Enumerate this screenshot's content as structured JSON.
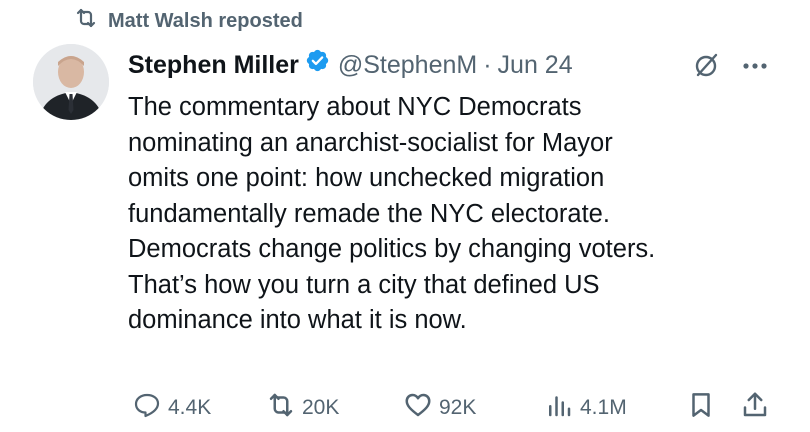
{
  "repost_banner": {
    "text": "Matt Walsh reposted",
    "icon": "repost-icon"
  },
  "author": {
    "name": "Stephen Miller",
    "handle": "@StephenM",
    "separator": "·",
    "date": "Jun 24",
    "verified": true,
    "verified_color": "#1d9bf0"
  },
  "tweet": {
    "lines": [
      "The commentary about NYC Democrats",
      "nominating an anarchist-socialist for Mayor",
      "omits one point: how unchecked migration",
      "fundamentally remade the NYC electorate.",
      "Democrats change politics by changing voters.",
      "That’s how you turn a city that defined US",
      "dominance into what it is now."
    ]
  },
  "actions": {
    "replies": "4.4K",
    "reposts": "20K",
    "likes": "92K",
    "views": "4.1M"
  },
  "colors": {
    "text": "#0f1419",
    "secondary": "#536471",
    "accent": "#1d9bf0"
  }
}
